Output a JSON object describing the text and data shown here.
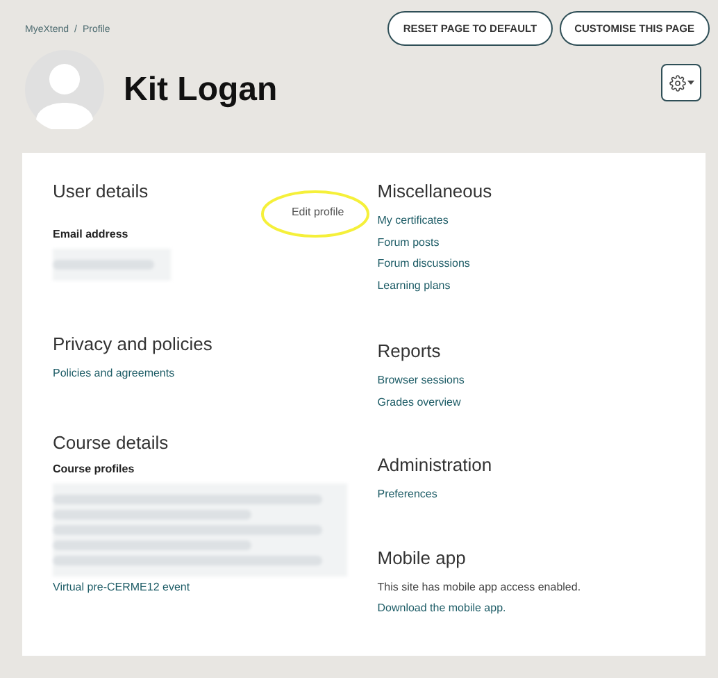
{
  "breadcrumb": {
    "items": [
      "MyeXtend",
      "Profile"
    ],
    "separator": "/"
  },
  "header_buttons": [
    "RESET PAGE TO DEFAULT",
    "CUSTOMISE THIS PAGE"
  ],
  "user": {
    "name": "Kit Logan"
  },
  "left_column": [
    {
      "title": "User details",
      "items": [
        {
          "kind": "side_link",
          "text": "Edit profile",
          "highlighted": true
        },
        {
          "kind": "label",
          "text": "Email address"
        },
        {
          "kind": "blurred_line"
        }
      ]
    },
    {
      "title": "Privacy and policies",
      "items": [
        {
          "kind": "link",
          "text": "Policies and agreements"
        }
      ]
    },
    {
      "title": "Course details",
      "items": [
        {
          "kind": "label",
          "text": "Course profiles"
        },
        {
          "kind": "blurred_block"
        },
        {
          "kind": "link",
          "text": "Virtual pre-CERME12 event"
        }
      ]
    }
  ],
  "right_column": [
    {
      "title": "Miscellaneous",
      "items": [
        {
          "kind": "link",
          "text": "My certificates"
        },
        {
          "kind": "link",
          "text": "Forum posts"
        },
        {
          "kind": "link",
          "text": "Forum discussions"
        },
        {
          "kind": "link",
          "text": "Learning plans"
        }
      ]
    },
    {
      "title": "Reports",
      "items": [
        {
          "kind": "link",
          "text": "Browser sessions"
        },
        {
          "kind": "link",
          "text": "Grades overview"
        }
      ]
    },
    {
      "title": "Administration",
      "items": [
        {
          "kind": "link",
          "text": "Preferences"
        }
      ]
    },
    {
      "title": "Mobile app",
      "items": [
        {
          "kind": "text",
          "text": "This site has mobile app access enabled."
        },
        {
          "kind": "link",
          "text": "Download the mobile app."
        }
      ]
    }
  ]
}
